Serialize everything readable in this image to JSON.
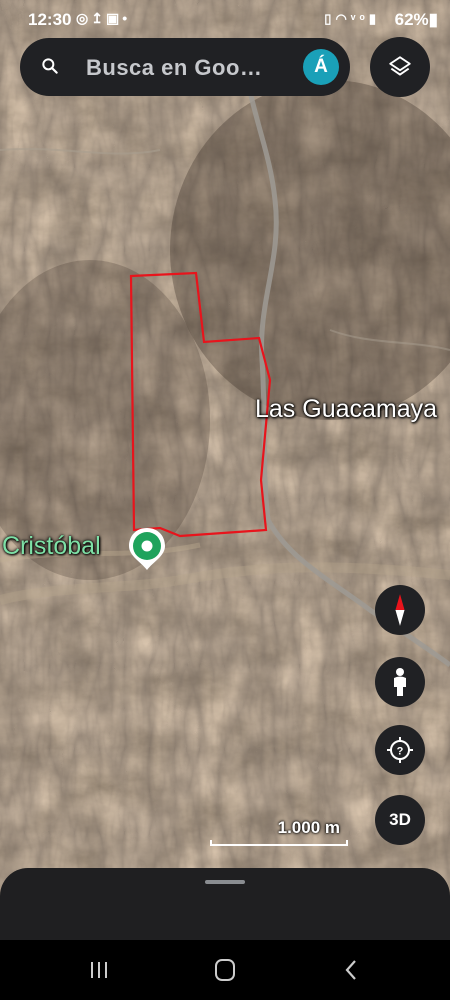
{
  "status_bar": {
    "time": "12:30",
    "left_icons": [
      "whatsapp-icon",
      "upload-icon",
      "gallery-icon",
      "dot-icon"
    ],
    "right_icons": [
      "battery-saver-icon",
      "wifi-icon",
      "volte-icon",
      "signal-icon"
    ],
    "battery": "62%"
  },
  "search": {
    "placeholder": "Busca en Goo…",
    "avatar_letter": "Á",
    "avatar_color": "#1aa0b8"
  },
  "map": {
    "labels": {
      "place_1": "Las Guacamaya",
      "place_2": "Cristóbal"
    },
    "boundary_color": "#e8141c",
    "pin_color": "#1fa35c",
    "scale_label": "1.000 m"
  },
  "controls": {
    "threed_label": "3D",
    "compass_colors": [
      "#e8141c",
      "#ffffff"
    ]
  }
}
